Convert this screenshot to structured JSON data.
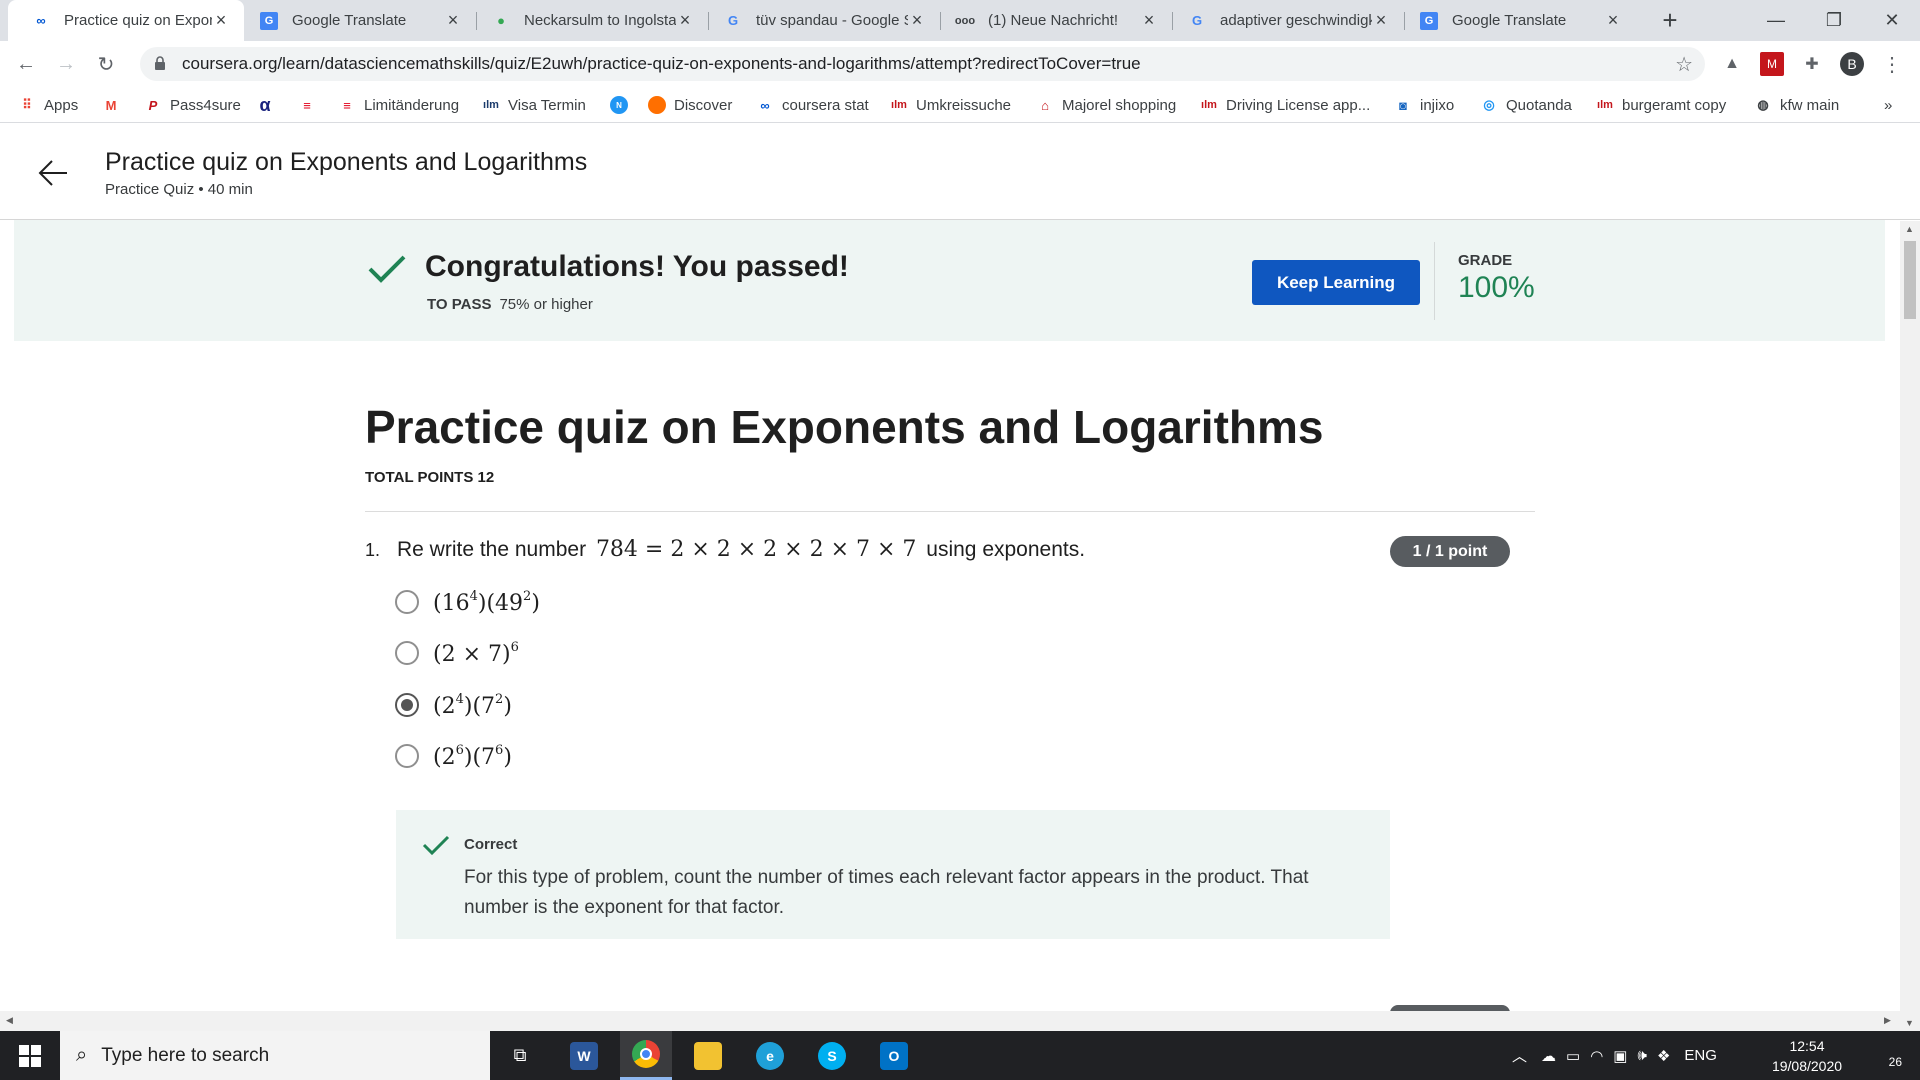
{
  "browser": {
    "tabs": [
      {
        "label": "Practice quiz on Expon",
        "icon": "coursera-icon",
        "active": true
      },
      {
        "label": "Google Translate",
        "icon": "google-translate-icon"
      },
      {
        "label": "Neckarsulm to Ingolsta",
        "icon": "maps-pin-icon"
      },
      {
        "label": "tüv spandau - Google S",
        "icon": "google-icon"
      },
      {
        "label": "(1) Neue Nachricht!",
        "icon": "mail-link-icon"
      },
      {
        "label": "adaptiver geschwindigk",
        "icon": "google-icon"
      },
      {
        "label": "Google Translate",
        "icon": "google-translate-icon"
      }
    ],
    "url": "coursera.org/learn/datasciencemathskills/quiz/E2uwh/practice-quiz-on-exponents-and-logarithms/attempt?redirectToCover=true",
    "profile_initial": "B",
    "bookmarks": [
      {
        "label": "Apps",
        "icon": "apps-grid-icon"
      },
      {
        "label": "",
        "icon": "gmail-icon"
      },
      {
        "label": "Pass4sure",
        "icon": "pass4sure-icon"
      },
      {
        "label": "",
        "icon": "alpha-icon"
      },
      {
        "label": "",
        "icon": "sparkasse-icon"
      },
      {
        "label": "Limitänderung",
        "icon": "sparkasse-icon"
      },
      {
        "label": "Visa Termin",
        "icon": "berlin-icon"
      },
      {
        "label": "",
        "icon": "badge-icon"
      },
      {
        "label": "Discover",
        "icon": "discover-icon"
      },
      {
        "label": "coursera stat",
        "icon": "coursera-icon"
      },
      {
        "label": "Umkreissuche",
        "icon": "berlin-icon"
      },
      {
        "label": "Majorel shopping",
        "icon": "shopping-bag-icon"
      },
      {
        "label": "Driving License app...",
        "icon": "berlin-icon"
      },
      {
        "label": "injixo",
        "icon": "injixo-icon"
      },
      {
        "label": "Quotanda",
        "icon": "quotanda-icon"
      },
      {
        "label": "burgeramt copy",
        "icon": "berlin-icon"
      },
      {
        "label": "kfw main",
        "icon": "globe-icon"
      }
    ],
    "more_bookmarks": "»"
  },
  "page_header": {
    "title": "Practice quiz on Exponents and Logarithms",
    "subtitle": "Practice Quiz • 40 min"
  },
  "result_banner": {
    "title": "Congratulations! You passed!",
    "to_pass_label": "TO PASS",
    "to_pass_value": "75% or higher",
    "button": "Keep Learning",
    "grade_label": "GRADE",
    "grade_value": "100%",
    "accent_color": "#1f8354"
  },
  "quiz": {
    "title": "Practice quiz on Exponents and Logarithms",
    "total_points": "TOTAL POINTS 12",
    "questions": [
      {
        "number": "1.",
        "text_before": "Re write the number",
        "math": "784 = 2 × 2 × 2 × 2 × 7 × 7",
        "text_after": "using exponents.",
        "points": "1 / 1 point",
        "options": [
          {
            "base1": "(16",
            "exp1": "4",
            "base2": ")(49",
            "exp2": "2",
            "tail": ")",
            "selected": false
          },
          {
            "base1": "(2 × 7)",
            "exp1": "6",
            "base2": "",
            "exp2": "",
            "tail": "",
            "selected": false
          },
          {
            "base1": "(2",
            "exp1": "4",
            "base2": ")(7",
            "exp2": "2",
            "tail": ")",
            "selected": true
          },
          {
            "base1": "(2",
            "exp1": "6",
            "base2": ")(7",
            "exp2": "6",
            "tail": ")",
            "selected": false
          }
        ],
        "feedback_label": "Correct",
        "feedback_text": "For this type of problem, count the number of times each relevant factor appears in the product. That number is the exponent for that factor."
      }
    ]
  },
  "taskbar": {
    "search_placeholder": "Type here to search",
    "language": "ENG",
    "time": "12:54",
    "date": "19/08/2020",
    "notifications": "26"
  }
}
